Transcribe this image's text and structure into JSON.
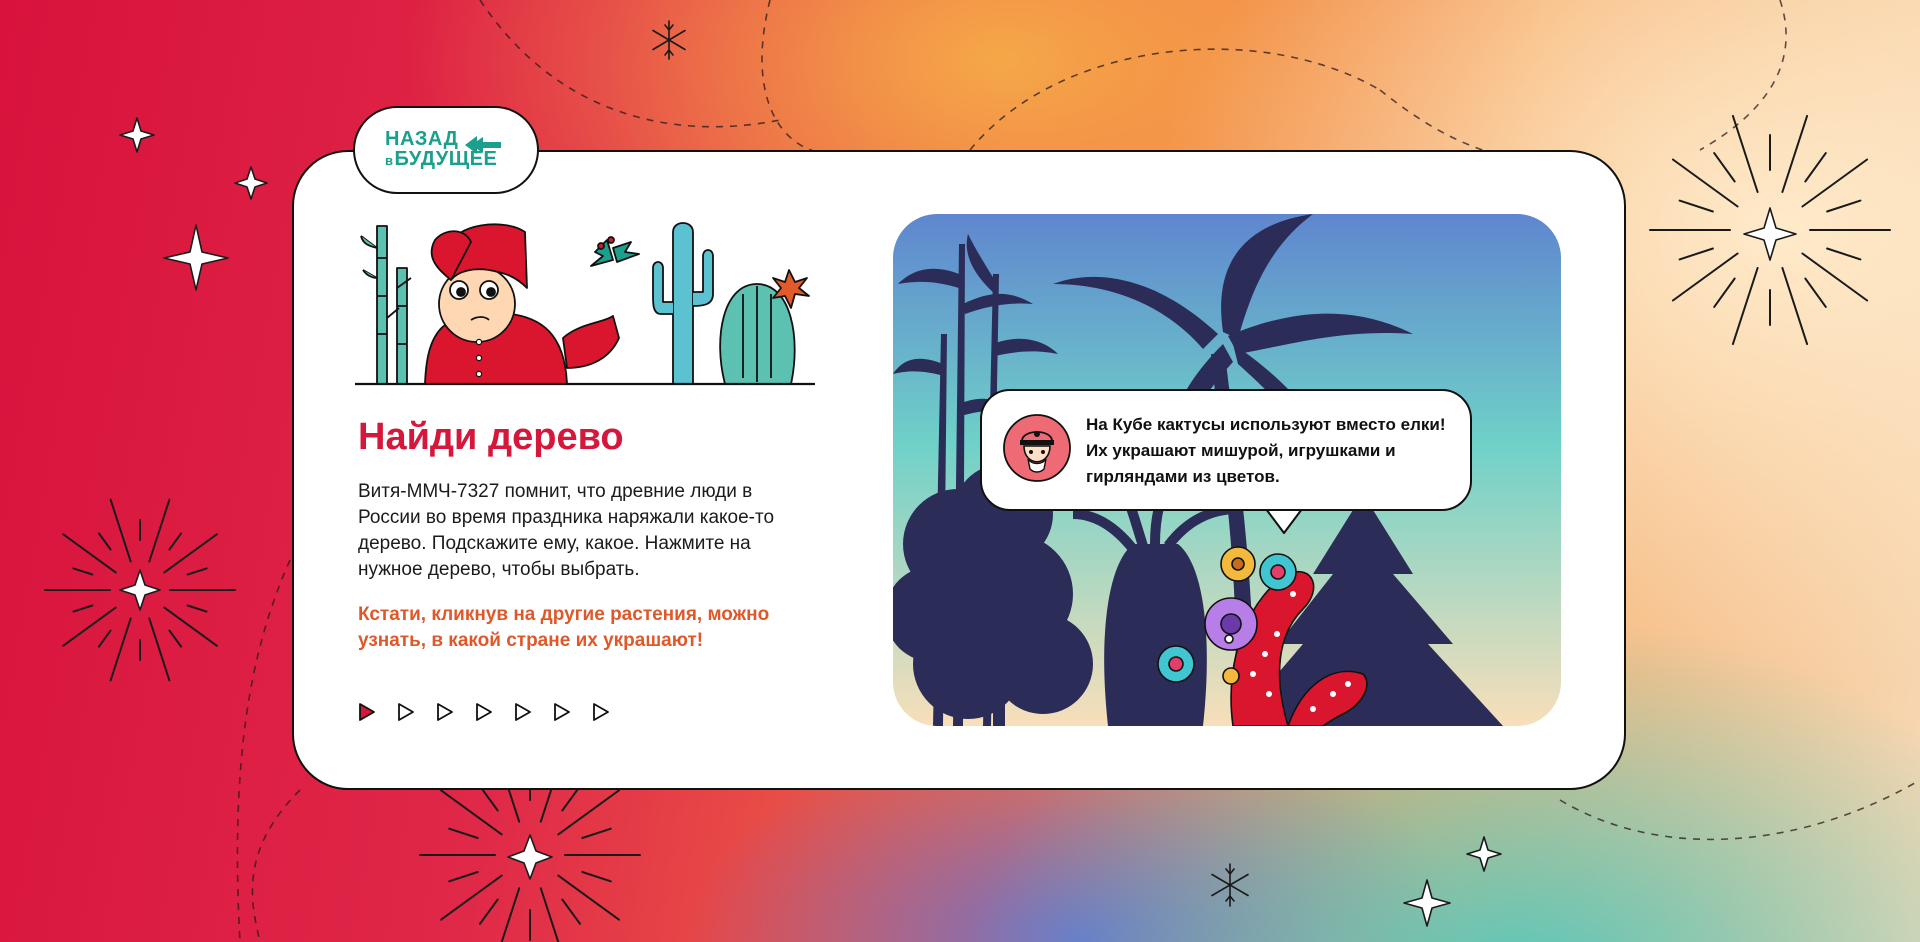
{
  "logo": {
    "line1": "НАЗАД",
    "line2_small": "в",
    "line2": "БУДУЩЕЕ"
  },
  "task": {
    "title": "Найди дерево",
    "description": "Витя-ММЧ-7327 помнит, что древние люди в России во время праздника наряжали какое-то дерево. Подскажите ему, какое. Нажмите на нужное дерево, чтобы выбрать.",
    "hint": "Кстати, кликнув на другие растения, можно узнать, в какой стране их украшают!"
  },
  "pager": {
    "total": 7,
    "active": 1
  },
  "bubble": {
    "text": "На Кубе кактусы используют вместо елки! Их украшают мишурой, игрушками и гирляндами из цветов."
  },
  "colors": {
    "accent_red": "#d4173a",
    "accent_orange": "#e0582a",
    "logo_teal": "#1aa08c",
    "silhouette": "#2c2c58"
  },
  "icons": [
    "sparkle-icon",
    "snowflake-icon",
    "firework-icon",
    "arrow-tree-icon",
    "play-triangle-icon",
    "police-robot-avatar-icon"
  ]
}
